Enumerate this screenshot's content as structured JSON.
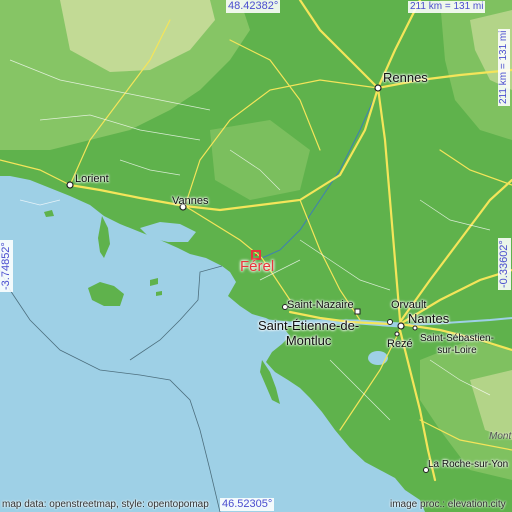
{
  "map": {
    "colors": {
      "sea": "#9ed0e6",
      "lowland": "#5fb24c",
      "midland": "#8dc86a",
      "highland": "#c9dc9a",
      "road": "#f4e55a",
      "marker": "#e8363c",
      "coord_text": "#4a4dcf"
    },
    "place": {
      "name": "Férel",
      "icon": "square-marker-icon"
    },
    "cities": {
      "rennes": "Rennes",
      "lorient": "Lorient",
      "vannes": "Vannes",
      "saint_nazaire": "Saint-Nazaire",
      "saint_etienne": "Saint-Étienne-de-\nMontluc",
      "orvault": "Orvault",
      "nantes": "Nantes",
      "reze": "Rezé",
      "saint_sebastien": "Saint-Sébastien-\nsur-Loire",
      "la_roche": "La Roche-sur-Yon",
      "montaigu": "Mont"
    },
    "coords": {
      "top": "48.42382°",
      "bottom": "46.52305°",
      "left": "-3.74852°",
      "right": "-0.33602°"
    },
    "scale": {
      "top": "211 km = 131 mi",
      "right": "211 km = 131 mi"
    },
    "credits": {
      "left": "map data: openstreetmap, style: opentopomap",
      "right": "image proc.: elevation.city"
    }
  }
}
